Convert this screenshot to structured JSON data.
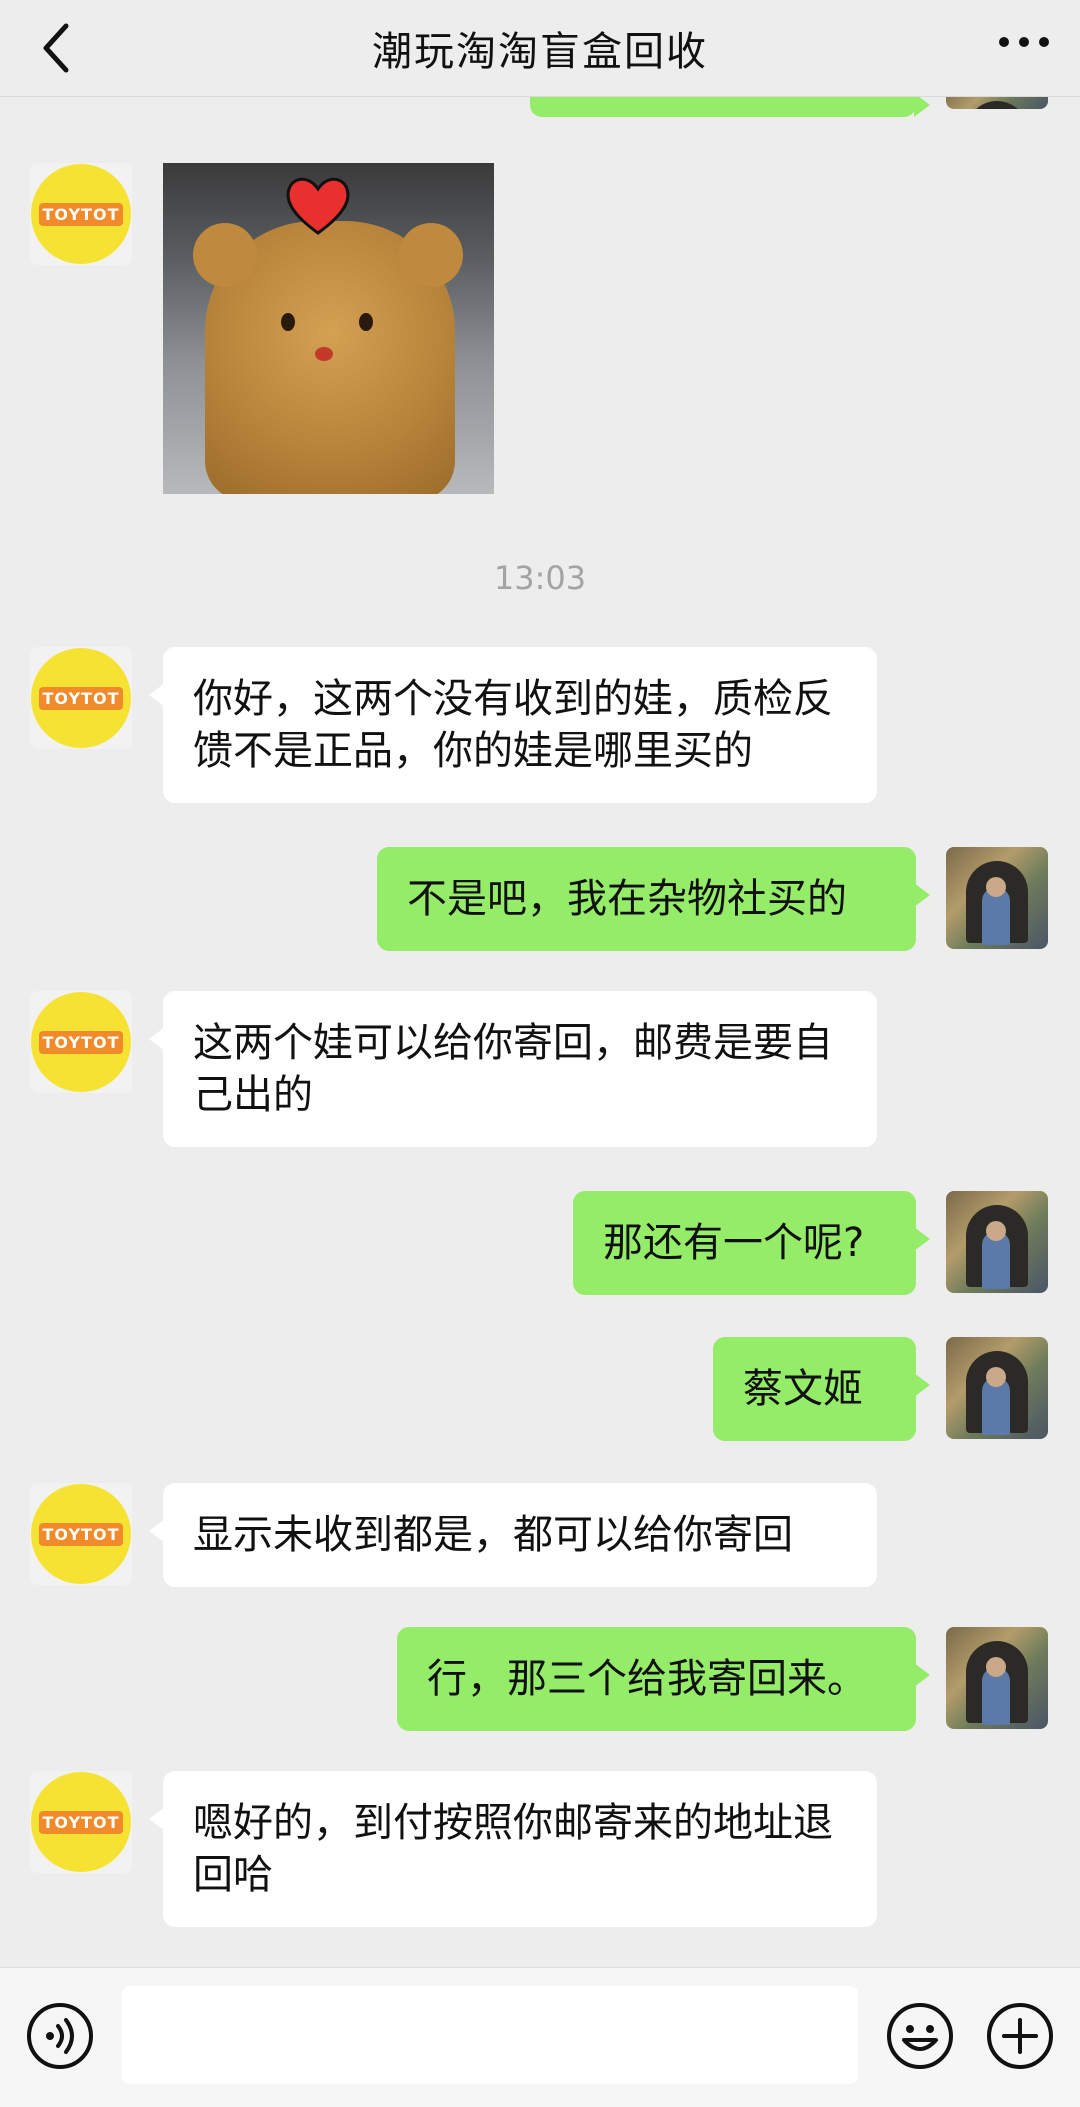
{
  "header": {
    "title": "潮玩淘淘盲盒回收"
  },
  "contacts": {
    "shop_logo_text": "TOYTOT"
  },
  "messages": [
    {
      "side": "left",
      "type": "sticker"
    },
    {
      "type": "time",
      "text": "13:03"
    },
    {
      "side": "left",
      "text": "你好，这两个没有收到的娃，质检反馈不是正品，你的娃是哪里买的"
    },
    {
      "side": "right",
      "text": "不是吧，我在杂物社买的"
    },
    {
      "side": "left",
      "text": "这两个娃可以给你寄回，邮费是要自己出的"
    },
    {
      "side": "right",
      "text": "那还有一个呢?"
    },
    {
      "side": "right",
      "text": "蔡文姬"
    },
    {
      "side": "left",
      "text": "显示未收到都是，都可以给你寄回"
    },
    {
      "side": "right",
      "text": "行，那三个给我寄回来。"
    },
    {
      "side": "left",
      "text": "嗯好的，到付按照你邮寄来的地址退回哈"
    }
  ],
  "input": {
    "value": ""
  },
  "colors": {
    "background": "#ededed",
    "bubble_self": "#95ec69",
    "bubble_other": "#ffffff"
  }
}
